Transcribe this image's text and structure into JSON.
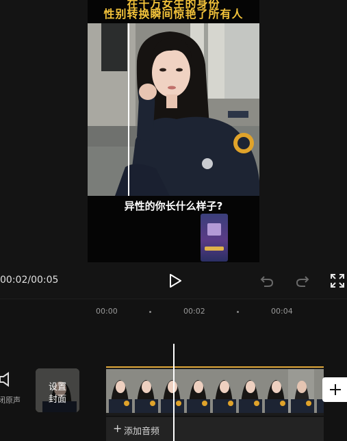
{
  "video": {
    "caption_top_line1": "在千万女生的身份",
    "caption_top_line2": "性别转换瞬间惊艳了所有人",
    "caption_bottom": "异性的你长什么样子?"
  },
  "player": {
    "time_readout": "00:02/00:05"
  },
  "timeline": {
    "ruler": [
      "00:00",
      "00:02",
      "00:04"
    ],
    "mute_label": "关闭原声",
    "cover_label_line1": "设置",
    "cover_label_line2": "封面",
    "add_audio_label": "添加音频",
    "add_audio_plus": "+"
  },
  "colors": {
    "background": "#141414",
    "caption_yellow": "#f2c23a",
    "clip_border": "#e1a83a"
  },
  "icons": {
    "play": "play-icon",
    "undo": "undo-icon",
    "redo": "redo-icon",
    "fullscreen": "fullscreen-icon",
    "mute": "speaker-mute-icon",
    "add_clip": "plus-icon"
  }
}
